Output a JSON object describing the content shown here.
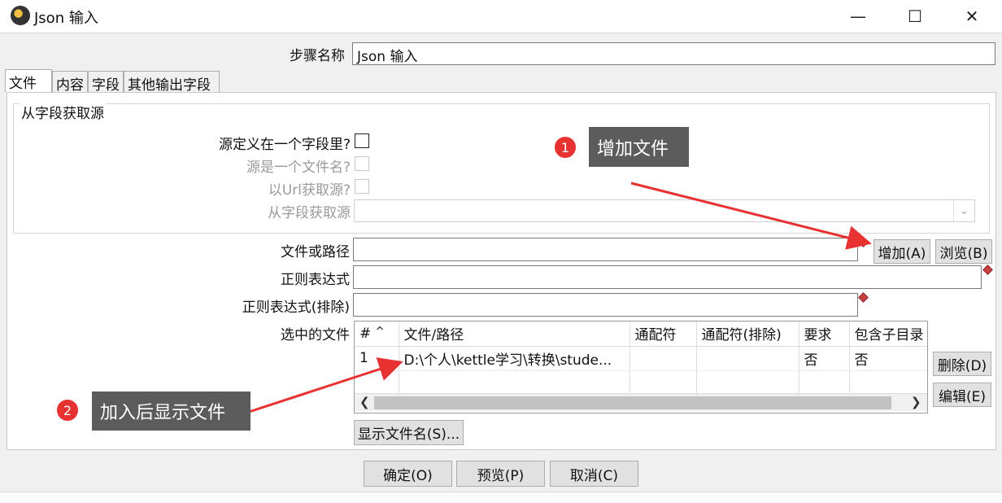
{
  "window": {
    "title": "Json 输入",
    "minimize": "—",
    "maximize": "☐",
    "close": "✕"
  },
  "step_name": {
    "label": "步骤名称",
    "value": "Json 输入"
  },
  "tabs": [
    {
      "label": "文件"
    },
    {
      "label": "内容"
    },
    {
      "label": "字段"
    },
    {
      "label": "其他输出字段"
    }
  ],
  "source_group": {
    "title": "从字段获取源",
    "source_in_field_label": "源定义在一个字段里?",
    "source_is_filename_label": "源是一个文件名?",
    "read_url_label": "以Url获取源?",
    "get_source_from_field_label": "从字段获取源"
  },
  "file": {
    "path_label": "文件或路径",
    "path_value": "",
    "regex_label": "正则表达式",
    "regex_value": "",
    "regex_exclude_label": "正则表达式(排除)",
    "regex_exclude_value": "",
    "selected_files_label": "选中的文件",
    "add_button": "增加(A)",
    "browse_button": "浏览(B)",
    "delete_button": "删除(D)",
    "edit_button": "编辑(E)",
    "show_filenames_button": "显示文件名(S)..."
  },
  "table": {
    "columns": [
      "#",
      "文件/路径",
      "通配符",
      "通配符(排除)",
      "要求",
      "包含子目录"
    ],
    "sort_indicator": "^",
    "rows": [
      {
        "num": "1",
        "path": "D:\\个人\\kettle学习\\转换\\stude...",
        "wildcard": "",
        "wildcard_exclude": "",
        "required": "否",
        "include_subfolders": "否"
      }
    ]
  },
  "buttons": {
    "ok": "确定(O)",
    "preview": "预览(P)",
    "cancel": "取消(C)"
  },
  "annotations": [
    {
      "number": "1",
      "text": "增加文件"
    },
    {
      "number": "2",
      "text": "加入后显示文件"
    }
  ],
  "colors": {
    "annotation_red": "#e83232",
    "annotation_box": "#5c5c5c",
    "required_marker": "#c94040"
  }
}
